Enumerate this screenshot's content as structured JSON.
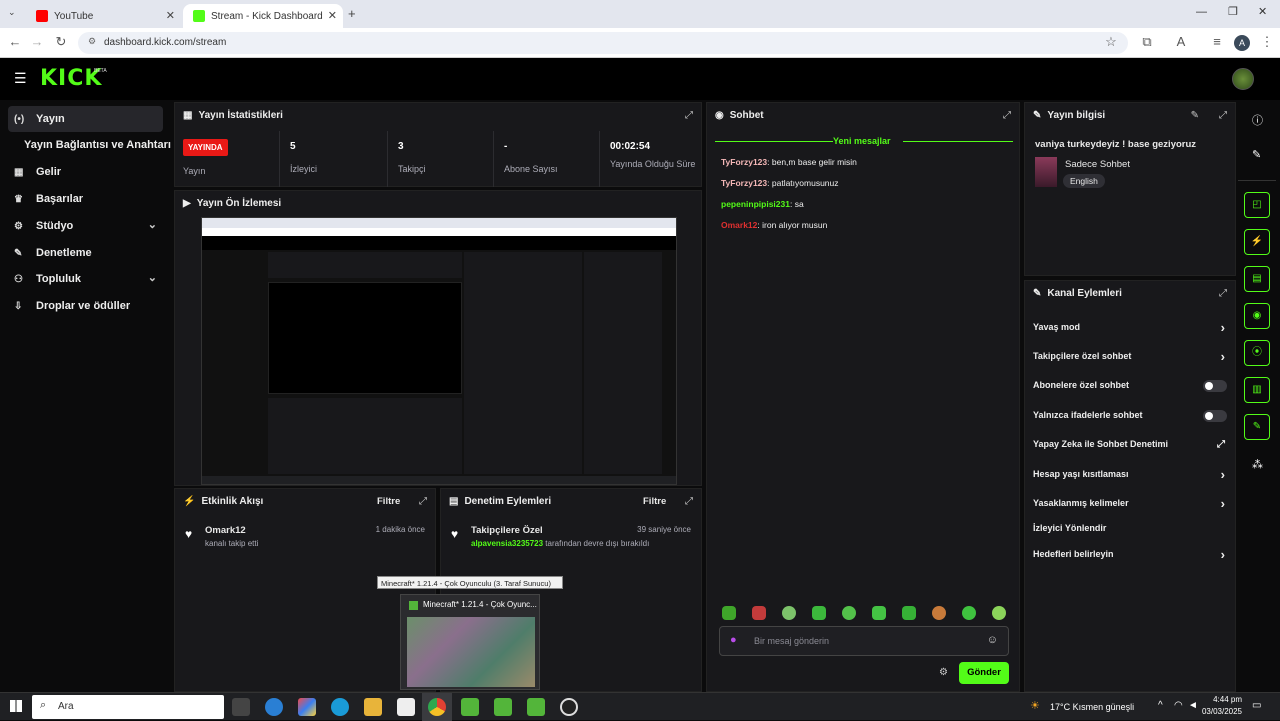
{
  "browser": {
    "tabs": [
      {
        "label": "YouTube",
        "active": false,
        "color": "#ff0000"
      },
      {
        "label": "Stream - Kick Dashboard",
        "active": true,
        "color": "#53fc18"
      }
    ],
    "url": "dashboard.kick.com/stream"
  },
  "kick": {
    "logo": "KICK",
    "beta": "BETA"
  },
  "sidebar": {
    "items": [
      {
        "label": "Yayın",
        "icon": "(•)"
      },
      {
        "label": "Yayın Bağlantısı ve Anahtarı",
        "icon": ""
      },
      {
        "label": "Gelir",
        "icon": "▦"
      },
      {
        "label": "Başarılar",
        "icon": "🏆"
      },
      {
        "label": "Stüdyo",
        "icon": "⚙"
      },
      {
        "label": "Denetleme",
        "icon": "🔧"
      },
      {
        "label": "Topluluk",
        "icon": "👥"
      },
      {
        "label": "Droplar ve ödüller",
        "icon": "⇩"
      }
    ]
  },
  "stats": {
    "title": "Yayın İstatistikleri",
    "live_badge": "YAYINDA",
    "live_label": "Yayın",
    "cells": [
      {
        "value": "5",
        "label": "İzleyici"
      },
      {
        "value": "3",
        "label": "Takipçi"
      },
      {
        "value": "-",
        "label": "Abone Sayısı"
      },
      {
        "value": "00:02:54",
        "label": "Yayında Olduğu Süre"
      }
    ]
  },
  "preview": {
    "title": "Yayın Ön İzlemesi"
  },
  "activity": {
    "title": "Etkinlik Akışı",
    "filter": "Filtre",
    "items": [
      {
        "name": "Omark12",
        "text": "kanalı takip etti",
        "time": "1 dakika önce"
      }
    ]
  },
  "moderation": {
    "title": "Denetim Eylemleri",
    "filter": "Filtre",
    "items": [
      {
        "name": "Takipçilere Özel",
        "user": "alpavensia3235723",
        "text": " tarafından devre dışı bırakıldı",
        "time": "39 saniye önce"
      }
    ]
  },
  "tooltip": {
    "text": "Minecraft* 1.21.4 - Çok Oyunculu (3. Taraf Sunucu)",
    "thumb_title": "Minecraft* 1.21.4 - Çok Oyunc..."
  },
  "chat": {
    "title": "Sohbet",
    "new_messages": "Yeni mesajlar",
    "messages": [
      {
        "user": "TyForzy123",
        "text": "ben,m base gelir misin",
        "color": "#f5b8b8"
      },
      {
        "user": "TyForzy123",
        "text": "patlatıyomusunuz",
        "color": "#f5b8b8"
      },
      {
        "user": "pepeninpipisi231",
        "text": "sa",
        "color": "#53fc18"
      },
      {
        "user": "Omark12",
        "text": "iron alıyor musun",
        "color": "#e03030"
      }
    ],
    "input_placeholder": "Bir mesaj gönderin",
    "send_label": "Gönder"
  },
  "stream_info": {
    "title": "Yayın bilgisi",
    "stream_title": "vaniya turkeydeyiz ! base geziyoruz",
    "category": "Sadece Sohbet",
    "language": "English"
  },
  "channel_actions": {
    "title": "Kanal Eylemleri",
    "items": [
      {
        "label": "Yavaş mod",
        "control": "arrow"
      },
      {
        "label": "Takipçilere özel sohbet",
        "control": "arrow"
      },
      {
        "label": "Abonelere özel sohbet",
        "control": "toggle"
      },
      {
        "label": "Yalnızca ifadelerle sohbet",
        "control": "toggle"
      },
      {
        "label": "Yapay Zeka ile Sohbet Denetimi",
        "control": "external"
      },
      {
        "label": "Hesap yaşı kısıtlaması",
        "control": "arrow"
      },
      {
        "label": "Yasaklanmış kelimeler",
        "control": "arrow"
      },
      {
        "label": "İzleyici Yönlendir",
        "control": "none"
      },
      {
        "label": "Hedefleri belirleyin",
        "control": "arrow"
      }
    ]
  },
  "taskbar": {
    "search": "Ara",
    "weather": "17°C  Kısmen güneşli",
    "time": "4:44 pm",
    "date": "03/03/2025"
  },
  "colors": {
    "accent": "#53fc18",
    "panel": "#18181b",
    "bg": "#0b0b0c",
    "live": "#e91916"
  }
}
